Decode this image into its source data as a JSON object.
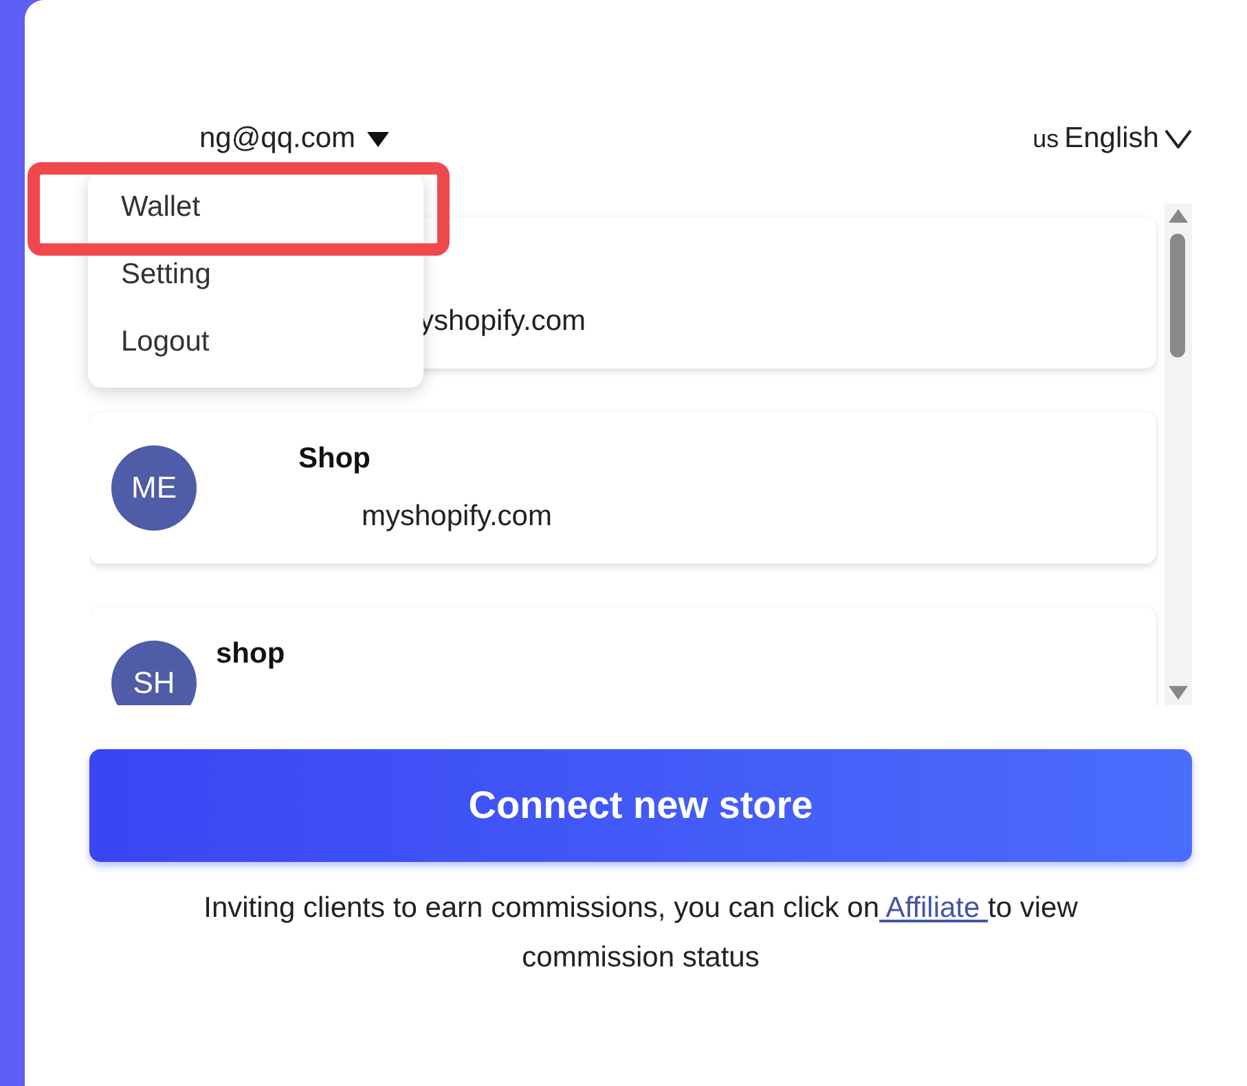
{
  "header": {
    "account": "ng@qq.com",
    "language_code": "us",
    "language": "English"
  },
  "account_menu": {
    "items": [
      {
        "label": "Wallet",
        "highlighted": true
      },
      {
        "label": "Setting",
        "highlighted": false
      },
      {
        "label": "Logout",
        "highlighted": false
      }
    ]
  },
  "stores": [
    {
      "domain": "yshopify.com"
    },
    {
      "initials": "ME",
      "name": "Shop",
      "domain": "myshopify.com"
    },
    {
      "initials": "SH",
      "name": "shop"
    }
  ],
  "connect_button": "Connect new store",
  "footer": {
    "before": "Inviting clients to earn commissions, you can click on",
    "link": " Affiliate ",
    "after": "to view commission status"
  }
}
